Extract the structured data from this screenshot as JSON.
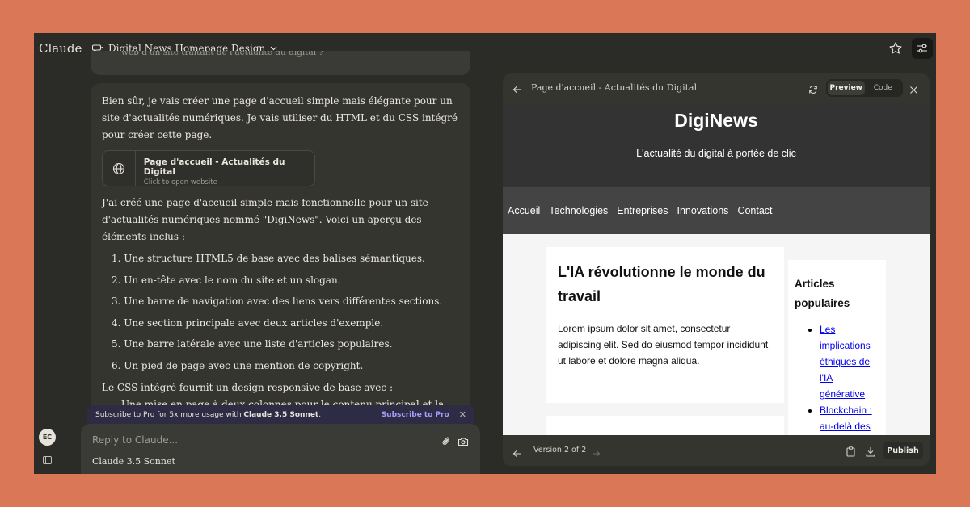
{
  "app": {
    "brand": "Claude",
    "conversation_title": "Digital News Homepage Design"
  },
  "user": {
    "initials": "EC"
  },
  "chat": {
    "previous_message_fragment": "web d'un site traitant de l'actualité du digital ?",
    "reply_intro": "Bien sûr, je vais créer une page d'accueil simple mais élégante pour un site d'actualités numériques. Je vais utiliser du HTML et du CSS intégré pour créer cette page.",
    "artifact_card": {
      "title": "Page d'accueil - Actualités du Digital",
      "subtitle": "Click to open website"
    },
    "reply_body": "J'ai créé une page d'accueil simple mais fonctionnelle pour un site d'actualités numériques nommé \"DigiNews\". Voici un aperçu des éléments inclus :",
    "list_items": [
      "1. Une structure HTML5 de base avec des balises sémantiques.",
      "2. Un en-tête avec le nom du site et un slogan.",
      "3. Une barre de navigation avec des liens vers différentes sections.",
      "4. Une section principale avec deux articles d'exemple.",
      "5. Une barre latérale avec une liste d'articles populaires.",
      "6. Un pied de page avec une mention de copyright."
    ],
    "reply_after": "Le CSS intégré fournit un design responsive de base avec :",
    "reply_cut_line": "Une mise en page à deux colonnes pour le contenu principal et la"
  },
  "promo": {
    "text_prefix": "Subscribe to Pro for 5x more usage with ",
    "text_model": "Claude 3.5 Sonnet",
    "text_suffix": ".",
    "cta": "Subscribe to Pro",
    "close": "✕"
  },
  "composer": {
    "placeholder": "Reply to Claude...",
    "model": "Claude 3.5 Sonnet"
  },
  "artifact": {
    "title": "Page d'accueil - Actualités du Digital",
    "tabs": {
      "preview": "Preview",
      "code": "Code"
    },
    "version": "Version 2 of 2",
    "publish": "Publish"
  },
  "site": {
    "title": "DigiNews",
    "slogan": "L'actualité du digital à portée de clic",
    "nav": [
      "Accueil",
      "Technologies",
      "Entreprises",
      "Innovations",
      "Contact"
    ],
    "article": {
      "heading": "L'IA révolutionne le monde du travail",
      "body": "Lorem ipsum dolor sit amet, consectetur adipiscing elit. Sed do eiusmod tempor incididunt ut labore et dolore magna aliqua."
    },
    "sidebar": {
      "heading": "Articles populaires",
      "links": [
        "Les implications éthiques de l'IA générative",
        "Blockchain : au-delà des cryptomonnaies"
      ]
    }
  },
  "colors": {
    "background": "#d97757",
    "app_bg": "#2b2b28",
    "accent": "#a89bff",
    "site_header": "#333333",
    "site_nav": "#444444"
  }
}
